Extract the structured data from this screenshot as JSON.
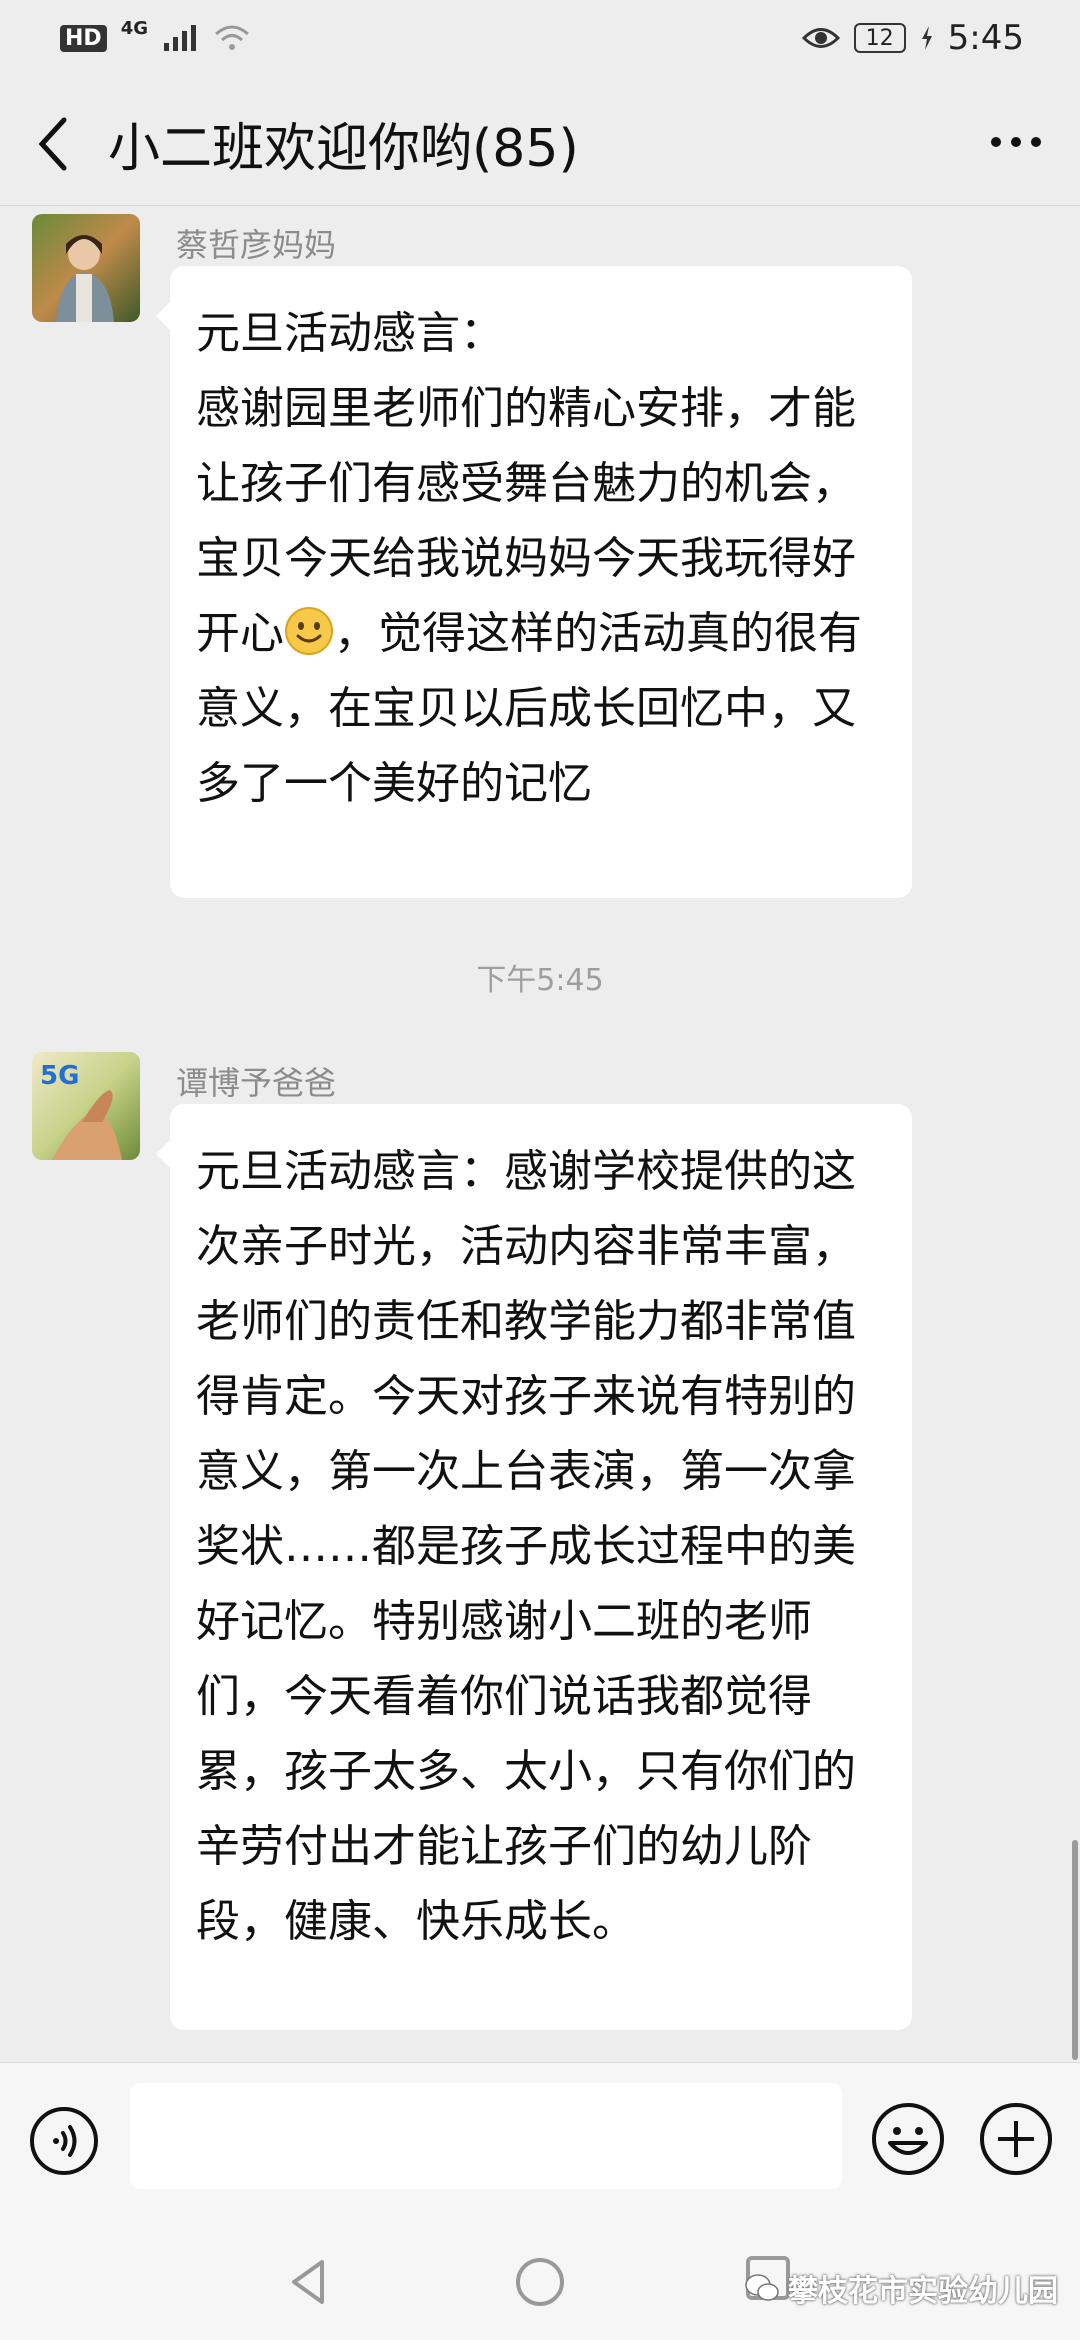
{
  "status_bar": {
    "hd": "HD",
    "network": "4G",
    "battery": "12",
    "time": "5:45"
  },
  "header": {
    "title": "小二班欢迎你哟(85)"
  },
  "messages": [
    {
      "sender": "蔡哲彦妈妈",
      "text_before_emoji": "元旦活动感言：\n感谢园里老师们的精心安排，才能让孩子们有感受舞台魅力的机会，宝贝今天给我说妈妈今天我玩得好开心",
      "text_after_emoji": "，觉得这样的活动真的很有意义，在宝贝以后成长回忆中，又多了一个美好的记忆"
    },
    {
      "sender": "谭博予爸爸",
      "text": "元旦活动感言：感谢学校提供的这次亲子时光，活动内容非常丰富，老师们的责任和教学能力都非常值得肯定。今天对孩子来说有特别的意义，第一次上台表演，第一次拿奖状……都是孩子成长过程中的美好记忆。特别感谢小二班的老师们，今天看着你们说话我都觉得累，孩子太多、太小，只有你们的辛劳付出才能让孩子们的幼儿阶段，健康、快乐成长。"
    }
  ],
  "timestamp": "下午5:45",
  "avatar_badge": "5G",
  "watermark": "攀枝花市实验幼儿园"
}
